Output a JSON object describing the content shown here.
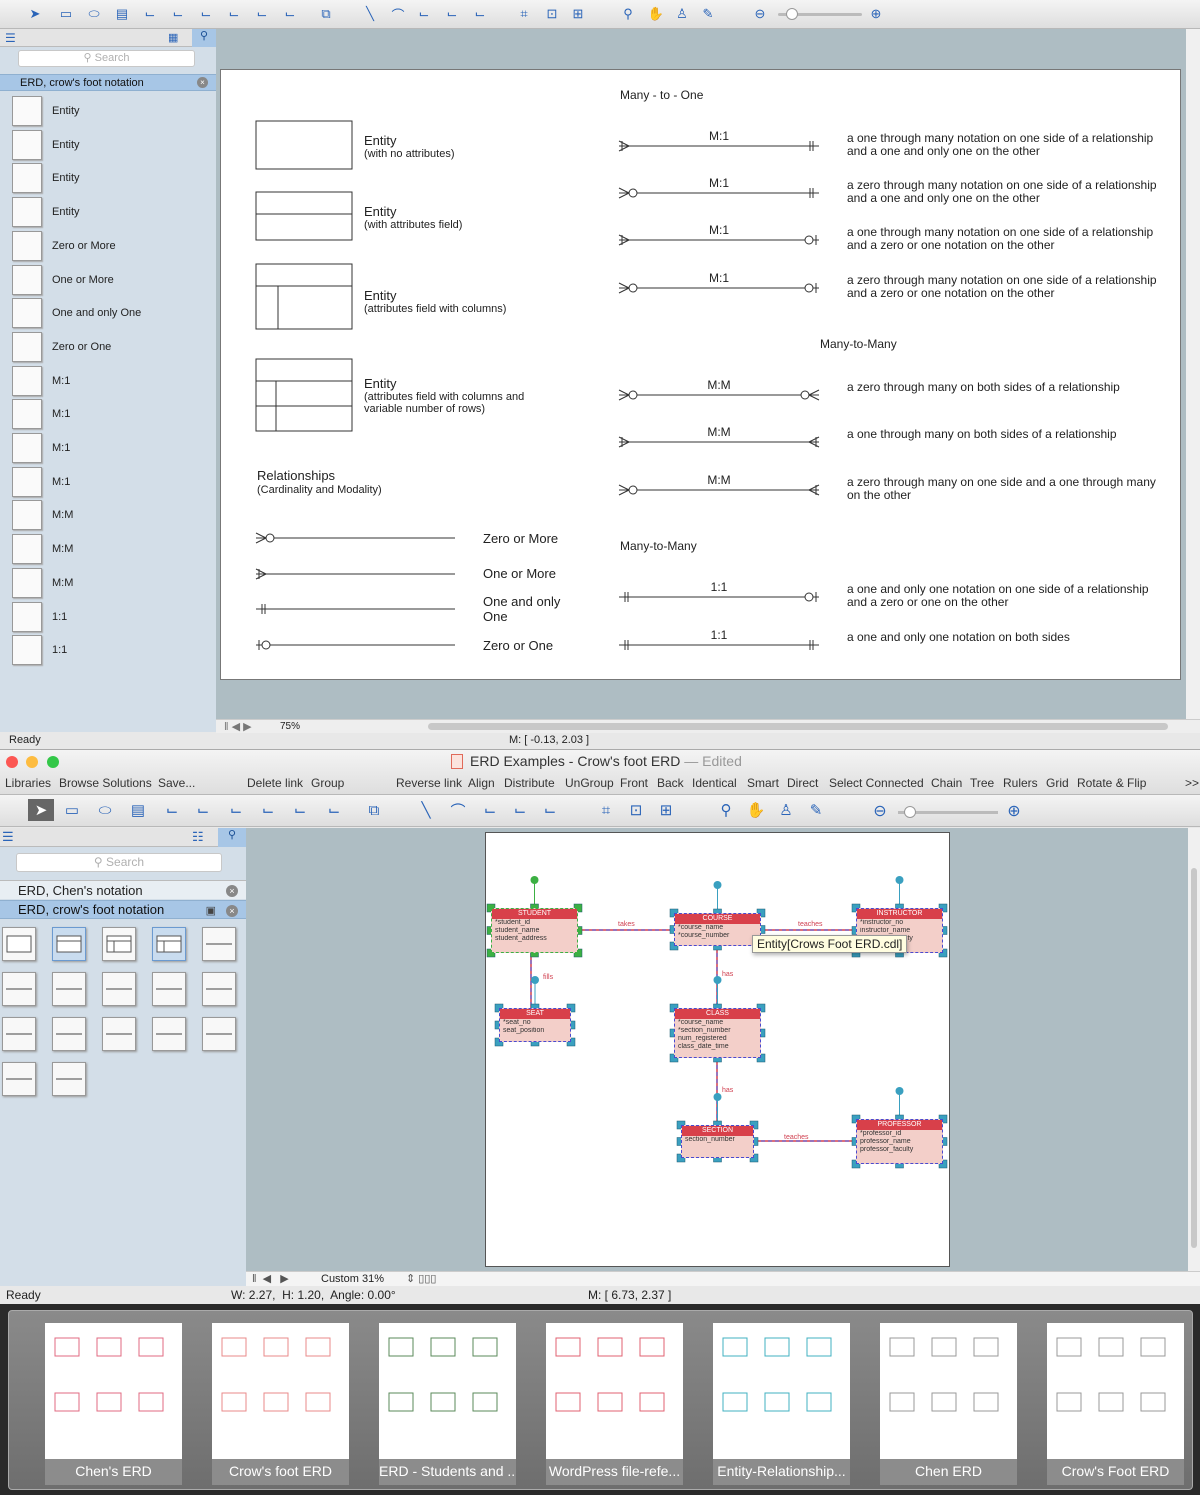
{
  "top_window": {
    "toolbar_icons": [
      "pointer-icon",
      "rectangle-icon",
      "ellipse-icon",
      "text-icon",
      "connector-icon",
      "smart-connector-icon",
      "tree-connector-icon",
      "orthogonal-connector-icon",
      "curved-connector-icon",
      "chain-connector-icon",
      "insert-icon",
      "line-icon",
      "arc-icon",
      "bezier-icon",
      "spline-icon",
      "round-connector-icon",
      "snap-icon",
      "fit-icon",
      "group-icon",
      "zoom-tool-icon",
      "hand-icon",
      "stamp-icon",
      "eyedropper-icon"
    ],
    "search_placeholder": "Search",
    "library_title": "ERD, crow's foot notation",
    "library_items": [
      "Entity",
      "Entity",
      "Entity",
      "Entity",
      "Zero or More",
      "One or More",
      "One and only One",
      "Zero or One",
      "M:1",
      "M:1",
      "M:1",
      "M:1",
      "M:M",
      "M:M",
      "M:M",
      "1:1",
      "1:1"
    ],
    "zoom_level": "75%",
    "status": "Ready",
    "mouse": "M: [ -0.13, 2.03 ]",
    "diagram": {
      "entities": [
        {
          "title": "Entity",
          "sub": "(with no attributes)"
        },
        {
          "title": "Entity",
          "sub": "(with attributes field)"
        },
        {
          "title": "Entity",
          "sub": "(attributes field with columns)"
        },
        {
          "title": "Entity",
          "sub": "(attributes field with columns and variable number of rows)"
        }
      ],
      "relationships_title": "Relationships",
      "relationships_sub": "(Cardinality and Modality)",
      "legend": [
        "Zero or More",
        "One or More",
        "One and only One",
        "Zero or One"
      ],
      "sections": [
        "Many - to - One",
        "Many-to-Many",
        "Many-to-Many"
      ],
      "rows": [
        {
          "label": "M:1",
          "desc": "a one through many notation on one side of a relationship and a one and only one on the other"
        },
        {
          "label": "M:1",
          "desc": "a zero through many notation on one side of a relationship and a one and only one on the other"
        },
        {
          "label": "M:1",
          "desc": "a one through many notation on one side of a relationship and a zero or one notation on the other"
        },
        {
          "label": "M:1",
          "desc": "a zero through many notation on one side of a relationship and a zero or one notation on the other"
        },
        {
          "label": "M:M",
          "desc": "a zero through many on both sides of a relationship"
        },
        {
          "label": "M:M",
          "desc": "a one through many on both sides of a relationship"
        },
        {
          "label": "M:M",
          "desc": "a zero through many on one side and a one through many on the other"
        },
        {
          "label": "1:1",
          "desc": "a one and only one notation on one side of a relationship and a zero or one on the other"
        },
        {
          "label": "1:1",
          "desc": "a one and only one notation on both sides"
        }
      ]
    }
  },
  "bottom_window": {
    "title": "ERD Examples - Crow's foot ERD",
    "title_suffix": "— Edited",
    "menu": [
      "Libraries",
      "Browse Solutions",
      "Save...",
      "Delete link",
      "Group",
      "Reverse link",
      "Align",
      "Distribute",
      "UnGroup",
      "Front",
      "Back",
      "Identical",
      "Smart",
      "Direct",
      "Select Connected",
      "Chain",
      "Tree",
      "Rulers",
      "Grid",
      "Rotate & Flip",
      ">>"
    ],
    "search_placeholder": "Search",
    "libraries": [
      "ERD, Chen's notation",
      "ERD, crow's foot notation"
    ],
    "zoom_level": "Custom 31%",
    "status": "Ready",
    "size": "W: 2.27,  H: 1.20,  Angle: 0.00°",
    "mouse": "M: [ 6.73, 2.37 ]",
    "tooltip": "Entity[Crows Foot ERD.cdl]",
    "erd": {
      "entities": [
        {
          "name": "STUDENT",
          "attrs": [
            "*student_id",
            "student_name",
            "student_address"
          ]
        },
        {
          "name": "COURSE",
          "attrs": [
            "*course_name",
            "*course_number"
          ]
        },
        {
          "name": "INSTRUCTOR",
          "attrs": [
            "*instructor_no",
            "instructor_name",
            "instructor_faculty"
          ]
        },
        {
          "name": "SEAT",
          "attrs": [
            "*seat_no",
            "seat_position"
          ]
        },
        {
          "name": "CLASS",
          "attrs": [
            "*course_name",
            "*section_number",
            "num_registered",
            "class_date_time"
          ]
        },
        {
          "name": "SECTION",
          "attrs": [
            "section_number"
          ]
        },
        {
          "name": "PROFESSOR",
          "attrs": [
            "*professor_id",
            "professor_name",
            "professor_faculty"
          ]
        }
      ],
      "links": [
        "takes",
        "teaches",
        "fills",
        "has",
        "has",
        "teaches"
      ]
    },
    "thumbnails": [
      "Chen's ERD",
      "Crow's foot ERD",
      "ERD - Students and ...",
      "WordPress file-refe...",
      "Entity-Relationship...",
      "Chen ERD",
      "Crow's Foot ERD"
    ],
    "colors": {
      "entity_header": "#d8404a",
      "entity_body": "#f3cfc9",
      "selection": "#3aa0c0",
      "accent": "#a7c6e6"
    }
  }
}
